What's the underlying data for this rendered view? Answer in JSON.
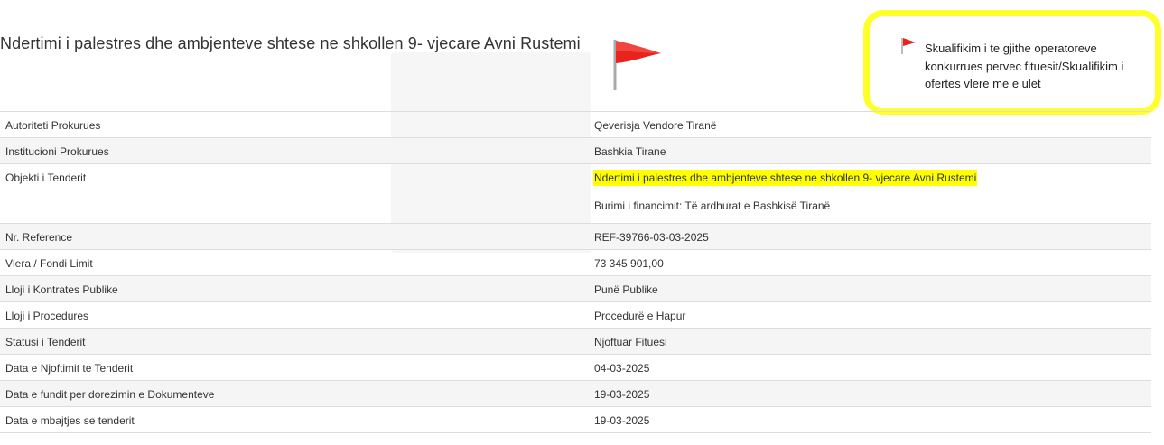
{
  "header": {
    "title": "Ndertimi i palestres dhe ambjenteve shtese ne shkollen 9- vjecare Avni Rustemi",
    "flag_icon": "red-flag-icon",
    "flag_color": "#e8221d"
  },
  "notice": {
    "text": "Skualifikim i te gjithe operatoreve konkurrues pervec fituesit/Skualifikim i ofertes vlere me e ulet",
    "highlight_color": "#ffff00"
  },
  "table": {
    "rows": [
      {
        "label": "Autoriteti Prokurues",
        "value": "Qeverisja Vendore Tiranë"
      },
      {
        "label": "Institucioni Prokurues",
        "value": "Bashkia Tirane"
      },
      {
        "label": "Objekti i Tenderit",
        "value": "Ndertimi i palestres dhe ambjenteve shtese ne shkollen 9- vjecare Avni Rustemi",
        "extra": "Burimi i financimit: Të ardhurat e Bashkisë Tiranë"
      },
      {
        "label": "Nr. Reference",
        "value": "REF-39766-03-03-2025"
      },
      {
        "label": "Vlera / Fondi Limit",
        "value": "73 345 901,00"
      },
      {
        "label": "Lloji i Kontrates Publike",
        "value": "Punë Publike"
      },
      {
        "label": "Lloji i Procedures",
        "value": "Procedurë e Hapur"
      },
      {
        "label": "Statusi i Tenderit",
        "value": "Njoftuar Fituesi"
      },
      {
        "label": "Data e Njoftimit te Tenderit",
        "value": "04-03-2025"
      },
      {
        "label": "Data e fundit per dorezimin e Dokumenteve",
        "value": "19-03-2025"
      },
      {
        "label": "Data e mbajtjes se tenderit",
        "value": "19-03-2025"
      }
    ]
  }
}
